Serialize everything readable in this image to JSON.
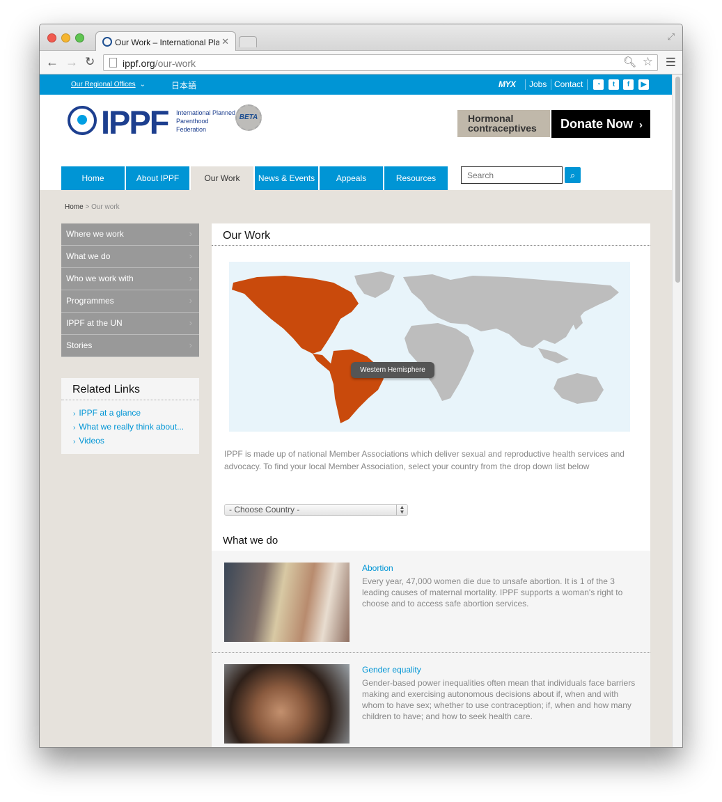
{
  "browser": {
    "tab_title": "Our Work – International Planned Parenthood Federation",
    "url_host": "ippf.org",
    "url_path": "/our-work"
  },
  "topbar": {
    "regional_offices": "Our Regional Offices",
    "language": "日本語",
    "myx": "MYX",
    "jobs": "Jobs",
    "contact": "Contact",
    "social": [
      "rss-icon",
      "twitter-icon",
      "facebook-icon",
      "youtube-icon"
    ]
  },
  "header": {
    "logo_text": "IPPF",
    "logo_sub": "International Planned Parenthood Federation",
    "beta": "BETA",
    "hormonal_banner": "Hormonal contraceptives",
    "donate": "Donate Now"
  },
  "nav": {
    "tabs": [
      {
        "label": "Home"
      },
      {
        "label": "About IPPF"
      },
      {
        "label": "Our Work"
      },
      {
        "label": "News & Events"
      },
      {
        "label": "Appeals"
      },
      {
        "label": "Resources"
      }
    ],
    "active_tab": "Our Work",
    "search_placeholder": "Search"
  },
  "breadcrumb": {
    "home": "Home",
    "separator": ">",
    "current": "Our work"
  },
  "sidebar": {
    "items": [
      {
        "label": "Where we work"
      },
      {
        "label": "What we do"
      },
      {
        "label": "Who we work with"
      },
      {
        "label": "Programmes"
      },
      {
        "label": "IPPF at the UN"
      },
      {
        "label": "Stories"
      }
    ],
    "related_title": "Related Links",
    "related_links": [
      {
        "label": "IPPF at a glance"
      },
      {
        "label": "What we really think about..."
      },
      {
        "label": "Videos"
      }
    ]
  },
  "main": {
    "title": "Our Work",
    "map_tooltip": "Western Hemisphere",
    "intro": "IPPF is made up of national Member Associations which deliver sexual and reproductive health services and advocacy. To find your local Member Association, select your country from the drop down list below",
    "country_select": "- Choose Country -",
    "what_we_do_title": "What we do",
    "items": [
      {
        "heading": "Abortion",
        "text": "Every year, 47,000 women die due to unsafe abortion. It is 1 of the 3 leading causes of maternal mortality. IPPF supports a woman's right to choose and to access safe abortion services."
      },
      {
        "heading": "Gender equality",
        "text": "Gender-based power inequalities often mean that individuals face barriers making and exercising autonomous decisions about if, when and with whom to have sex; whether to use contraception; if, when and how many children to have; and how to seek health care."
      }
    ]
  },
  "colors": {
    "brand_blue": "#0095d5",
    "logo_navy": "#1d3f8f",
    "map_highlight": "#c94a0c",
    "map_land": "#bdbdbd"
  }
}
